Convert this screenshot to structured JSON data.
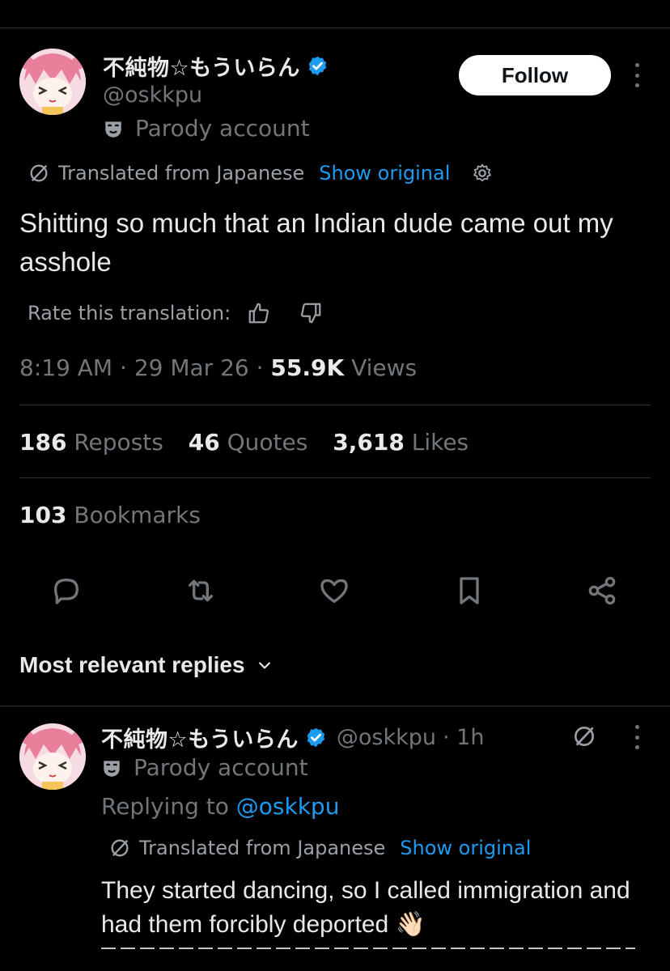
{
  "post": {
    "author": {
      "display_name": "不純物☆もういらん",
      "handle": "@oskkpu",
      "parody_label": "Parody account",
      "verified": true
    },
    "follow_label": "Follow",
    "translation": {
      "label": "Translated from Japanese",
      "show_original": "Show original"
    },
    "text": "Shitting so much that an Indian dude came out my asshole",
    "rate_label": "Rate this translation:",
    "time": "8:19 AM",
    "date": "29 Mar 26",
    "views_count": "55.9K",
    "views_label": "Views",
    "separator": "·",
    "stats": {
      "reposts_count": "186",
      "reposts_label": "Reposts",
      "quotes_count": "46",
      "quotes_label": "Quotes",
      "likes_count": "3,618",
      "likes_label": "Likes",
      "bookmarks_count": "103",
      "bookmarks_label": "Bookmarks"
    },
    "actions": [
      "reply-icon",
      "repost-icon",
      "like-icon",
      "bookmark-icon",
      "share-icon"
    ]
  },
  "replies_sort_label": "Most relevant replies",
  "reply": {
    "author": {
      "display_name": "不純物☆もういらん",
      "handle": "@oskkpu",
      "time_ago": "· 1h",
      "parody_label": "Parody account",
      "verified": true
    },
    "replying_prefix": "Replying to",
    "replying_to": "@oskkpu",
    "translation": {
      "label": "Translated from Japanese",
      "show_original": "Show original"
    },
    "text": "They started dancing, so I called immigration and had them forcibly deported",
    "emoji": "👋🏻"
  },
  "colors": {
    "background": "#000000",
    "text": "#e7e9ea",
    "muted": "#71767b",
    "accent": "#1d9bf0",
    "divider": "#2f3336"
  }
}
